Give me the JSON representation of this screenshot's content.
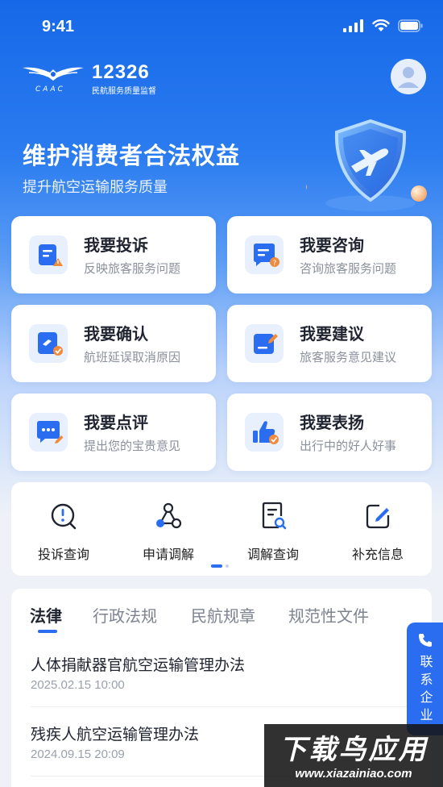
{
  "status": {
    "time": "9:41"
  },
  "brand": {
    "number": "12326",
    "subtitle": "民航服务质量监督",
    "caac": "CAAC"
  },
  "hero": {
    "title": "维护消费者合法权益",
    "subtitle": "提升航空运输服务质量"
  },
  "cards": [
    {
      "title": "我要投诉",
      "subtitle": "反映旅客服务问题",
      "icon": "complaint-icon"
    },
    {
      "title": "我要咨询",
      "subtitle": "咨询旅客服务问题",
      "icon": "consult-icon"
    },
    {
      "title": "我要确认",
      "subtitle": "航班延误取消原因",
      "icon": "confirm-icon"
    },
    {
      "title": "我要建议",
      "subtitle": "旅客服务意见建议",
      "icon": "suggest-icon"
    },
    {
      "title": "我要点评",
      "subtitle": "提出您的宝贵意见",
      "icon": "review-icon"
    },
    {
      "title": "我要表扬",
      "subtitle": "出行中的好人好事",
      "icon": "praise-icon"
    }
  ],
  "quick_actions": [
    {
      "label": "投诉查询",
      "icon": "complaint-query-icon"
    },
    {
      "label": "申请调解",
      "icon": "mediation-apply-icon"
    },
    {
      "label": "调解查询",
      "icon": "mediation-query-icon"
    },
    {
      "label": "补充信息",
      "icon": "supplement-icon"
    }
  ],
  "regulation_tabs": [
    "法律",
    "行政法规",
    "民航规章",
    "规范性文件"
  ],
  "regulation_items": [
    {
      "title": "人体捐献器官航空运输管理办法",
      "date": "2025.02.15 10:00"
    },
    {
      "title": "残疾人航空运输管理办法",
      "date": "2024.09.15 20:09"
    }
  ],
  "contact": {
    "label": "联系企业"
  },
  "watermark": {
    "line1": "下载鸟应用",
    "line2": "www.xiazainiao.com"
  },
  "colors": {
    "primary": "#2a6df0",
    "warning": "#f08a3c"
  }
}
